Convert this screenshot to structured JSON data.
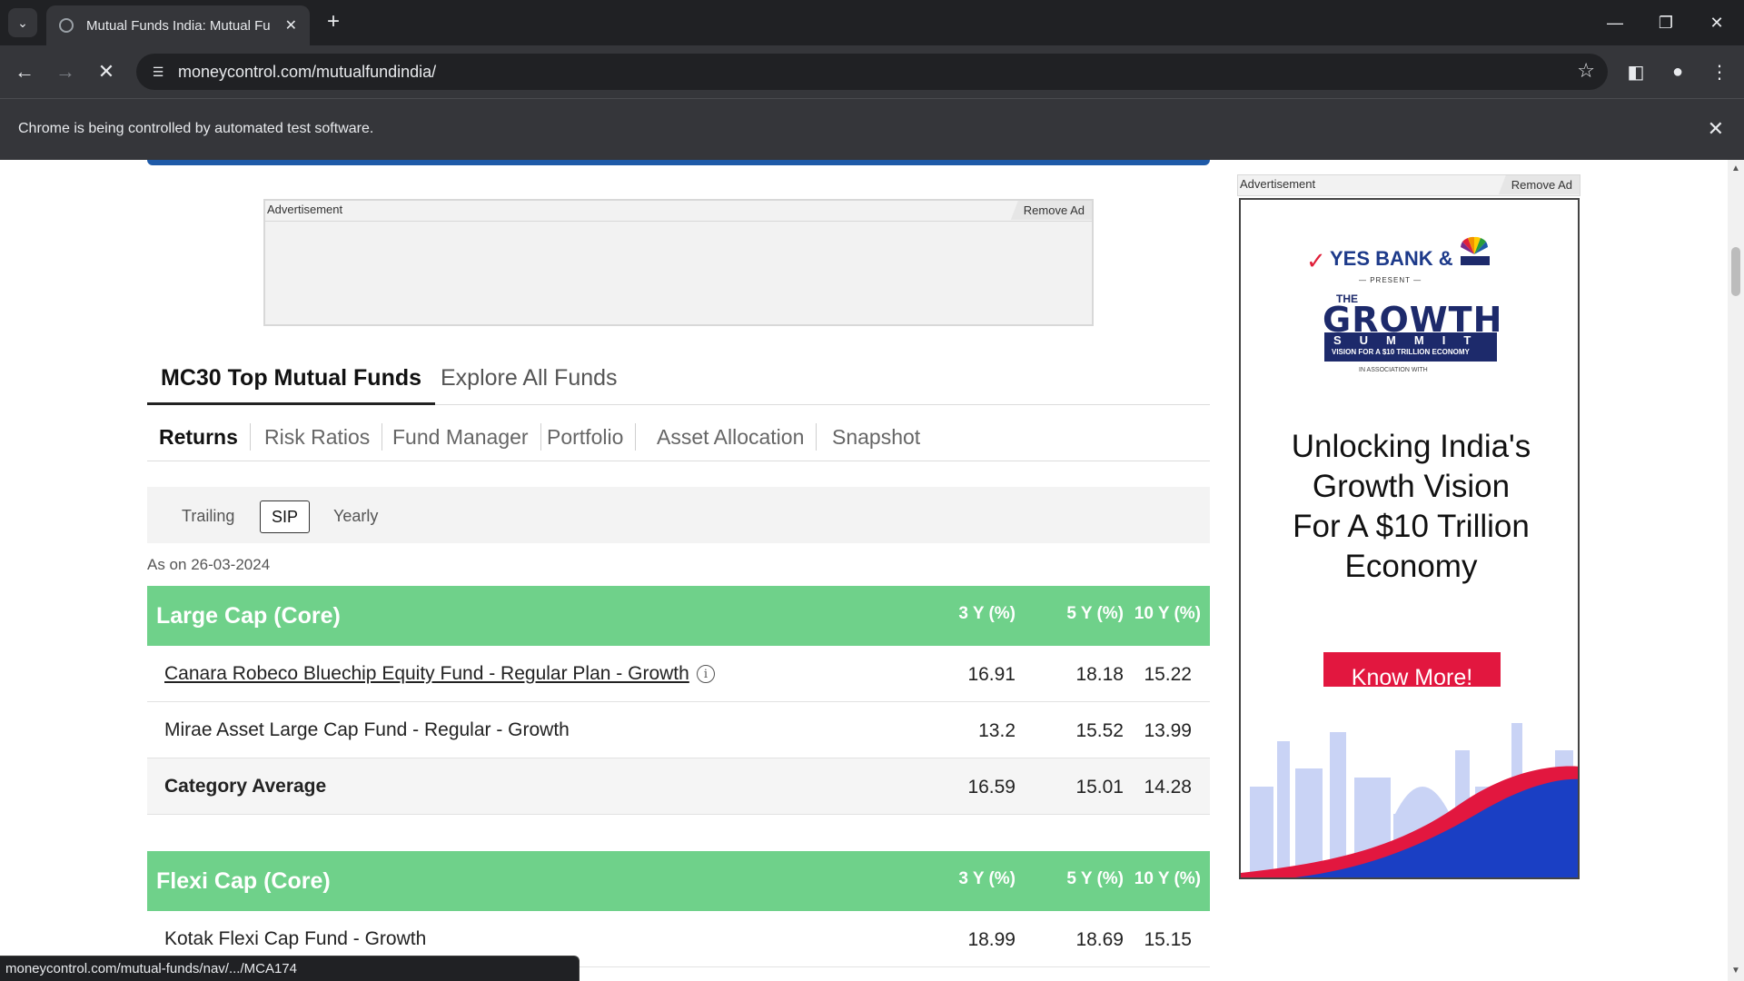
{
  "browser": {
    "tab_title": "Mutual Funds India: Mutual Fu",
    "url": "moneycontrol.com/mutualfundindia/",
    "infobar_message": "Chrome is being controlled by automated test software.",
    "status_url": "moneycontrol.com/mutual-funds/nav/.../MCA174"
  },
  "ads": {
    "label": "Advertisement",
    "remove_label": "Remove Ad",
    "right": {
      "sponsor": "YES BANK &",
      "present": "— PRESENT —",
      "the": "THE",
      "event": "GROWTH",
      "summit": "SUMMIT",
      "tagline": "VISION FOR A $10 TRILLION ECONOMY",
      "assoc": "IN ASSOCIATION WITH",
      "headline_lines": [
        "Unlocking India's",
        "Growth Vision",
        "For A $10 Trillion",
        "Economy"
      ],
      "cta": "Know More!",
      "colors": {
        "cta": "#e2173f",
        "navy": "#1d2a6b",
        "wave": "#1a3fc4"
      }
    }
  },
  "main_tabs": [
    {
      "label": "MC30 Top Mutual Funds",
      "active": true
    },
    {
      "label": "Explore All Funds",
      "active": false
    }
  ],
  "sub_tabs": [
    {
      "label": "Returns",
      "active": true
    },
    {
      "label": "Risk Ratios",
      "active": false
    },
    {
      "label": "Fund Manager",
      "active": false
    },
    {
      "label": "Portfolio",
      "active": false
    },
    {
      "label": "Asset Allocation",
      "active": false
    },
    {
      "label": "Snapshot",
      "active": false
    }
  ],
  "periods": [
    {
      "label": "Trailing",
      "active": false
    },
    {
      "label": "SIP",
      "active": true
    },
    {
      "label": "Yearly",
      "active": false
    }
  ],
  "as_on": "As on 26-03-2024",
  "columns": [
    "3 Y (%)",
    "5 Y (%)",
    "10 Y (%)"
  ],
  "categories": [
    {
      "title": "Large Cap (Core)",
      "rows": [
        {
          "name": "Canara Robeco Bluechip Equity Fund - Regular Plan - Growth",
          "values": [
            "16.91",
            "18.18",
            "15.22"
          ]
        },
        {
          "name": "Mirae Asset Large Cap Fund - Regular - Growth",
          "values": [
            "13.2",
            "15.52",
            "13.99"
          ]
        },
        {
          "name": "Category Average",
          "values": [
            "16.59",
            "15.01",
            "14.28"
          ]
        }
      ]
    },
    {
      "title": "Flexi Cap (Core)",
      "rows": [
        {
          "name": "Kotak Flexi Cap Fund - Growth",
          "values": [
            "18.99",
            "18.69",
            "15.15"
          ]
        }
      ]
    }
  ],
  "colors": {
    "category_header": "#6fd18a",
    "chrome_dark": "#202124",
    "chrome_mid": "#35363a"
  }
}
